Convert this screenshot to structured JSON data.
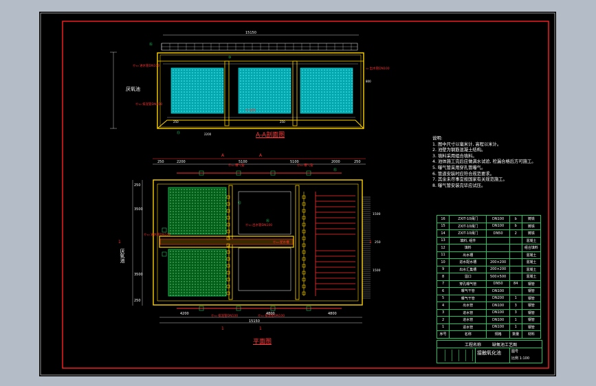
{
  "drawing": {
    "section_title": "A-A剖面图",
    "plan_title": "平面图",
    "tank_label": "厌氧池",
    "tank_label_plan": "厌氧池",
    "dim_top_section": "15150",
    "dim_bottom_plan": "15150",
    "section_mark_1": "1",
    "section_mark_a": "A",
    "dims_plan_top": [
      "250",
      "2200",
      "5100",
      "5100",
      "2000",
      "250"
    ],
    "dims_plan_left": [
      "250",
      "3500",
      "3500",
      "250"
    ],
    "dims_plan_bottom": [
      "4200",
      "4800",
      "4800"
    ]
  },
  "notes": {
    "heading": "说明:",
    "lines": [
      "1. 图中尺寸以毫米计, 高程以米计。",
      "2. 池壁为钢筋混凝土结构。",
      "3. 填料采用组合填料。",
      "4. 池体施工完后应做满水试验, 检漏合格后方可施工。",
      "5. 曝气管采用穿孔管曝气。",
      "6. 管道安装时应符合规范要求。",
      "7. 其余未尽事宜按国家有关规范施工。",
      "8. 曝气管安装完毕应试压。"
    ]
  },
  "parts_table": {
    "rows": [
      [
        "16",
        "ZXIT-10阀门",
        "DN100",
        "b",
        "铸铁"
      ],
      [
        "15",
        "ZXIT-10阀门",
        "DN100",
        "b",
        "铸铁"
      ],
      [
        "14",
        "ZXIT-10阀门",
        "DN50",
        "2",
        "铸铁"
      ],
      [
        "13",
        "填料, 组件",
        "",
        "",
        "混凝土"
      ],
      [
        "12",
        "填料",
        "",
        "",
        "组合填料"
      ],
      [
        "11",
        "出水槽",
        "",
        "",
        "混凝土"
      ],
      [
        "10",
        "进水配水槽",
        "200×200",
        "",
        "混凝土"
      ],
      [
        "9",
        "出水汇集槽",
        "200×200",
        "",
        "混凝土"
      ],
      [
        "8",
        "溢口",
        "500×500",
        "",
        "混凝土"
      ],
      [
        "7",
        "穿孔曝气管",
        "DN50",
        "84",
        "钢管"
      ],
      [
        "6",
        "曝气干管",
        "DN100",
        "",
        "钢管"
      ],
      [
        "5",
        "曝气干管",
        "DN200",
        "1",
        "钢管"
      ],
      [
        "4",
        "出水管",
        "DN100",
        "3",
        "钢管"
      ],
      [
        "3",
        "进水管",
        "DN100",
        "3",
        "钢管"
      ],
      [
        "2",
        "进水管",
        "DN100",
        "1",
        "钢管"
      ],
      [
        "1",
        "进水管",
        "DN100",
        "1",
        "钢管"
      ],
      [
        "序号",
        "名称",
        "规格",
        "数量",
        "材料"
      ]
    ]
  },
  "title_block": {
    "project": "工程名称",
    "drawing_name": "缺氧池工艺图",
    "tank": "接触氧化池",
    "scale": "比例 1:100",
    "sheet": "图号"
  },
  "colors": {
    "frame": "#ff2020",
    "wall": "#ffd400",
    "water": "#00c8c8",
    "fill_green": "#22c55e",
    "pipe_red": "#ff3030",
    "dim_white": "#ffffff",
    "sheet_bg": "#000000",
    "page_bg": "#b4bcc8"
  }
}
